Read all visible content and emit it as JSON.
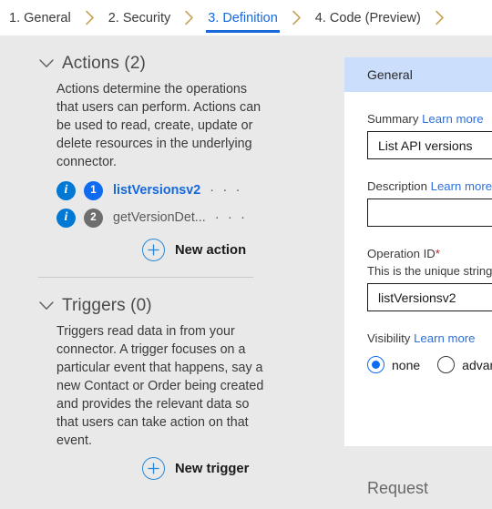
{
  "wizard": {
    "tabs": [
      {
        "label": "1. General",
        "active": false
      },
      {
        "label": "2. Security",
        "active": false
      },
      {
        "label": "3. Definition",
        "active": true
      },
      {
        "label": "4. Code (Preview)",
        "active": false
      }
    ],
    "separator_icon": "chevron-right-icon"
  },
  "left_panel": {
    "actions_section": {
      "collapse_icon": "chevron-down-icon",
      "title": "Actions (2)",
      "description": "Actions determine the operations that users can perform. Actions can be used to read, create, update or delete resources in the underlying connector.",
      "items": [
        {
          "info_icon": "info-icon",
          "badge": "1",
          "name": "listVersionsv2",
          "selected": true,
          "overflow_icon": "ellipsis-icon",
          "overflow_label": "· · ·"
        },
        {
          "info_icon": "info-icon",
          "badge": "2",
          "name": "getVersionDet...",
          "selected": false,
          "overflow_icon": "ellipsis-icon",
          "overflow_label": "· · ·"
        }
      ],
      "new_button": {
        "icon": "plus-circle-icon",
        "label": "New action"
      }
    },
    "triggers_section": {
      "collapse_icon": "chevron-down-icon",
      "title": "Triggers (0)",
      "description": "Triggers read data in from your connector. A trigger focuses on a particular event that happens, say a new Contact or Order being created and provides the relevant data so that users can take action on that event.",
      "new_button": {
        "icon": "plus-circle-icon",
        "label": "New trigger"
      }
    }
  },
  "right_panel": {
    "header_title": "General",
    "summary": {
      "label": "Summary",
      "learn_more": "Learn more",
      "value": "List API versions",
      "placeholder": ""
    },
    "description": {
      "label": "Description",
      "learn_more": "Learn more",
      "value": "",
      "placeholder": ""
    },
    "operation_id": {
      "label": "Operation ID",
      "required_mark": "*",
      "hint": "This is the unique string us",
      "value": "listVersionsv2",
      "placeholder": ""
    },
    "visibility": {
      "label": "Visibility",
      "learn_more": "Learn more",
      "options": [
        {
          "label": "none",
          "checked": true
        },
        {
          "label": "advanc",
          "checked": false
        }
      ]
    },
    "request_section_title": "Request"
  },
  "colors": {
    "accent_blue": "#1668dc",
    "panel_header_blue": "#cbdefb",
    "page_bg": "#e9e9e9",
    "info_blue": "#0078d4",
    "badge_idle_gray": "#6e6e6e",
    "required_red": "#a4262c",
    "chevron_gold": "#c8a45c"
  }
}
